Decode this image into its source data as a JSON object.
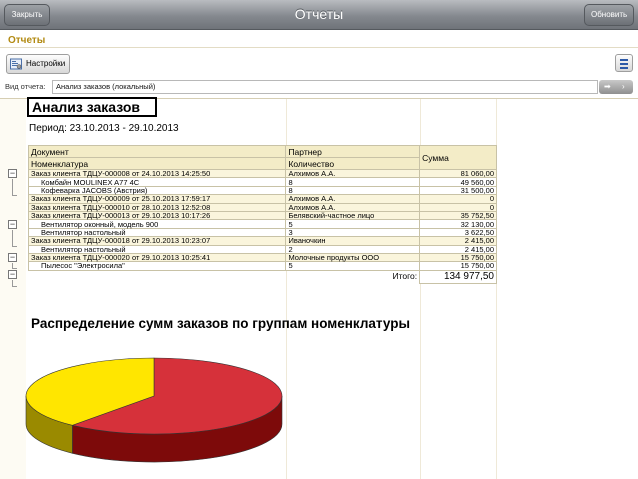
{
  "toolbar": {
    "close_label": "Закрыть",
    "title": "Отчеты",
    "refresh_label": "Обновить"
  },
  "section": {
    "title": "Отчеты"
  },
  "settings": {
    "label": "Настройки"
  },
  "view": {
    "label": "Вид отчета:",
    "value": "Анализ заказов (локальный)"
  },
  "report": {
    "title": "Анализ заказов",
    "period": "Период: 23.10.2013 - 29.10.2013",
    "headers": {
      "document": "Документ",
      "nomenclature": "Номенклатура",
      "partner": "Партнер",
      "quantity": "Количество",
      "sum": "Сумма"
    },
    "rows": [
      {
        "kind": "grp",
        "name": "Заказ клиента ТДЦУ-000008 от 24.10.2013 14:25:50",
        "partner": "Алхимов А.А.",
        "sum": "81 060,00"
      },
      {
        "kind": "itm",
        "name": "Комбайн MOULINEX  A77 4C",
        "partner": "8",
        "sum": "49 560,00"
      },
      {
        "kind": "itm",
        "name": "Кофеварка JACOBS (Австрия)",
        "partner": "8",
        "sum": "31 500,00"
      },
      {
        "kind": "grp",
        "name": "Заказ клиента ТДЦУ-000009 от 25.10.2013 17:59:17",
        "partner": "Алхимов А.А.",
        "sum": "0"
      },
      {
        "kind": "grp",
        "name": "Заказ клиента ТДЦУ-000010 от 28.10.2013 12:52:08",
        "partner": "Алхимов А.А.",
        "sum": "0"
      },
      {
        "kind": "grp",
        "name": "Заказ клиента ТДЦУ-000013 от 29.10.2013 10:17:26",
        "partner": "Белявский-частное лицо",
        "sum": "35 752,50"
      },
      {
        "kind": "itm",
        "name": "Вентилятор оконный, модель 900",
        "partner": "5",
        "sum": "32 130,00"
      },
      {
        "kind": "itm",
        "name": "Вентилятор настольный",
        "partner": "3",
        "sum": "3 622,50"
      },
      {
        "kind": "grp",
        "name": "Заказ клиента ТДЦУ-000018 от 29.10.2013 10:23:07",
        "partner": "Иваночкин",
        "sum": "2 415,00"
      },
      {
        "kind": "itm",
        "name": "Вентилятор настольный",
        "partner": "2",
        "sum": "2 415,00"
      },
      {
        "kind": "grp",
        "name": "Заказ клиента ТДЦУ-000020 от 29.10.2013 10:25:41",
        "partner": "Молочные продукты ООО",
        "sum": "15 750,00"
      },
      {
        "kind": "itm",
        "name": "Пылесос \"Электросила\"",
        "partner": "5",
        "sum": "15 750,00"
      }
    ],
    "total_label": "Итого:",
    "total_value": "134 977,50",
    "chart_title": "Распределение сумм заказов по группам номенклатуры"
  },
  "chart_data": {
    "type": "pie",
    "slices": [
      {
        "value": 61,
        "color": "#d6313a",
        "side": "#7d0a0a"
      },
      {
        "value": 39,
        "color": "#ffe600",
        "side": "#9a8a00"
      }
    ]
  }
}
